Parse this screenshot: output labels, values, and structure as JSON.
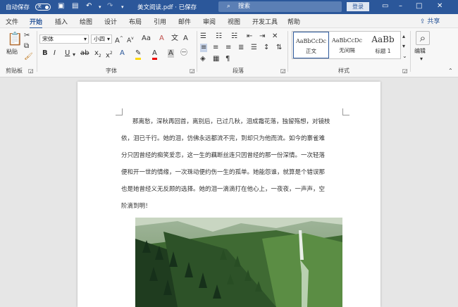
{
  "titlebar": {
    "autosave_label": "自动保存",
    "autosave_state": "关",
    "doc_title": "美文阅读.pdf · 已保存",
    "search_placeholder": "搜索",
    "login_label": "登录"
  },
  "tabs": [
    "文件",
    "开始",
    "插入",
    "绘图",
    "设计",
    "布局",
    "引用",
    "邮件",
    "审阅",
    "视图",
    "开发工具",
    "帮助"
  ],
  "active_tab": "开始",
  "share_label": "共享",
  "ribbon": {
    "paste_label": "粘贴",
    "clipboard_label": "剪贴板",
    "font_name": "宋体",
    "font_size": "小四",
    "font_group_label": "字体",
    "paragraph_group_label": "段落",
    "styles_group_label": "样式",
    "styles": [
      {
        "sample": "AaBbCcDc",
        "name": "正文"
      },
      {
        "sample": "AaBbCcDc",
        "name": "无间隔"
      },
      {
        "sample": "AaBb",
        "name": "标题 1"
      }
    ],
    "edit_label": "编辑"
  },
  "document": {
    "lines": [
      "那离愁，深秋再回首，离别后，已过几秋，泪成霜花落，独留殇想，对镜枝",
      "依，泪已千行。她的泪，仿佛永远都流不完，到却只为他而流。如今的寨雀难",
      "分只因曾经的痴笑爱恋，这一生的藕断丝连只因曾经的那一份深情。一次轻落",
      "便和开一世的情缘，一次珠动便约伤一生的孤单。她能怨谁，就算是个错误那",
      "也是她曾经义无反顾的选择。她的泪一滴滴打在他心上，一夜夜，一声声，空",
      "阶滴到明！"
    ]
  }
}
